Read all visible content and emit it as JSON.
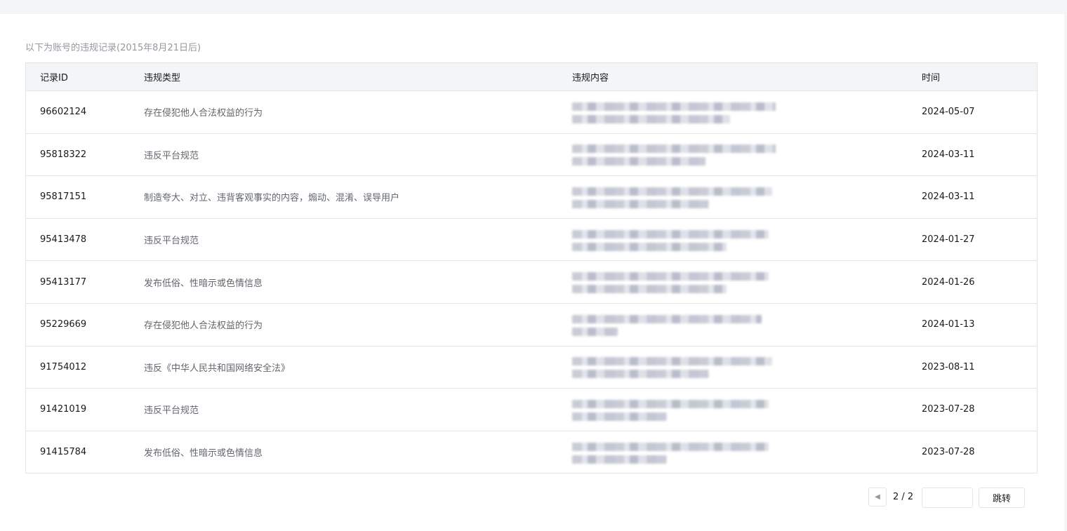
{
  "caption": "以下为账号的违规记录(2015年8月21日后)",
  "table": {
    "headers": {
      "id": "记录ID",
      "type": "违规类型",
      "content": "违规内容",
      "time": "时间"
    },
    "rows": [
      {
        "id": "96602124",
        "type": "存在侵犯他人合法权益的行为",
        "time": "2024-05-07"
      },
      {
        "id": "95818322",
        "type": "违反平台规范",
        "time": "2024-03-11"
      },
      {
        "id": "95817151",
        "type": "制造夸大、对立、违背客观事实的内容，煽动、混淆、误导用户",
        "time": "2024-03-11"
      },
      {
        "id": "95413478",
        "type": "违反平台规范",
        "time": "2024-01-27"
      },
      {
        "id": "95413177",
        "type": "发布低俗、性暗示或色情信息",
        "time": "2024-01-26"
      },
      {
        "id": "95229669",
        "type": "存在侵犯他人合法权益的行为",
        "time": "2024-01-13"
      },
      {
        "id": "91754012",
        "type": "违反《中华人民共和国网络安全法》",
        "time": "2023-08-11"
      },
      {
        "id": "91421019",
        "type": "违反平台规范",
        "time": "2023-07-28"
      },
      {
        "id": "91415784",
        "type": "发布低俗、性暗示或色情信息",
        "time": "2023-07-28"
      }
    ]
  },
  "pager": {
    "prev_icon": "caret-left-icon",
    "page_text": "2 / 2",
    "jump_value": "",
    "jump_label": "跳转"
  }
}
